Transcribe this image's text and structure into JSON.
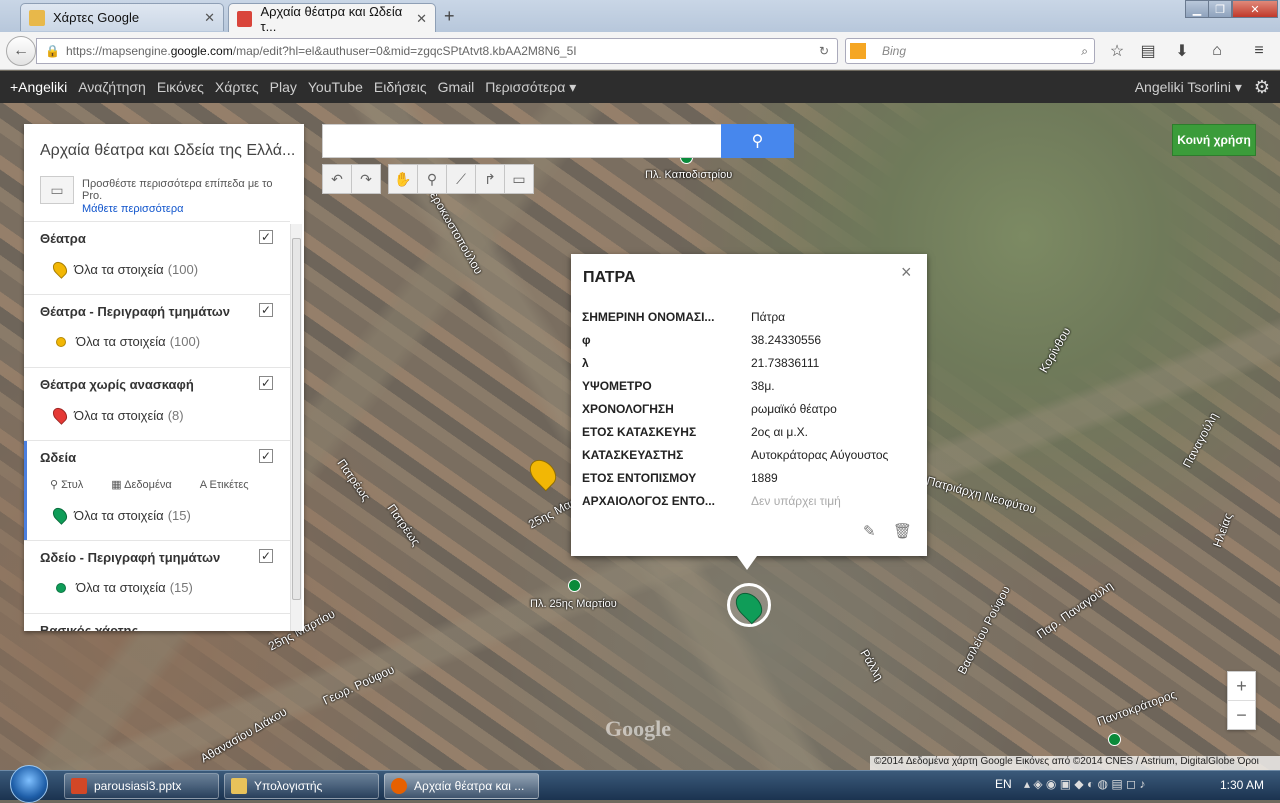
{
  "browser": {
    "tabs": [
      {
        "title": "Χάρτες Google",
        "active": false
      },
      {
        "title": "Αρχαία θέατρα και Ωδεία τ...",
        "active": true
      }
    ],
    "url_prefix": "https://mapsengine.",
    "url_host": "google.com",
    "url_rest": "/map/edit?hl=el&authuser=0&mid=zgqcSPtAtvt8.kbAA2M8N6_5I",
    "search_engine_placeholder": "Bing"
  },
  "google_bar": {
    "items": [
      "+Angeliki",
      "Αναζήτηση",
      "Εικόνες",
      "Χάρτες",
      "Play",
      "YouTube",
      "Ειδήσεις",
      "Gmail",
      "Περισσότερα ▾"
    ],
    "user": "Angeliki Tsorlini ▾"
  },
  "panel": {
    "title": "Αρχαία θέατρα και Ωδεία της Ελλά...",
    "pro_text": "Προσθέστε περισσότερα επίπεδα με το Pro.",
    "pro_link": "Μάθετε περισσότερα",
    "all_items_label": "Όλα τα στοιχεία",
    "layers": [
      {
        "title": "Θέατρα",
        "count": "(100)",
        "icon_color": "#f2b705",
        "icon": "pin-icon"
      },
      {
        "title": "Θέατρα - Περιγραφή τμημάτων",
        "count": "(100)",
        "icon_color": "#f2b705",
        "icon": "dot-icon"
      },
      {
        "title": "Θέατρα χωρίς ανασκαφή",
        "count": "(8)",
        "icon_color": "#e53935",
        "icon": "pin-icon"
      },
      {
        "title": "Ωδεία",
        "count": "(15)",
        "icon_color": "#0f9d58",
        "icon": "pin-icon"
      },
      {
        "title": "Ωδείο - Περιγραφή τμημάτων",
        "count": "(15)",
        "icon_color": "#0f9d58",
        "icon": "dot-icon"
      },
      {
        "title": "Βασικός χάρτης"
      }
    ],
    "subtools": {
      "style": "Στυλ",
      "data": "Δεδομένα",
      "labels": "Ετικέτες"
    }
  },
  "share_button": "Κοινή χρήση",
  "info": {
    "name": "ΠΑΤΡΑ",
    "rows": [
      {
        "key": "ΣΗΜΕΡΙΝΗ ΟΝΟΜΑΣΙ...",
        "value": "Πάτρα"
      },
      {
        "key": "φ",
        "value": "38.24330556"
      },
      {
        "key": "λ",
        "value": "21.73836111"
      },
      {
        "key": "ΥΨΟΜΕΤΡΟ",
        "value": "38μ."
      },
      {
        "key": "ΧΡΟΝΟΛΟΓΗΣΗ",
        "value": "ρωμαϊκό θέατρο"
      },
      {
        "key": "ΕΤΟΣ ΚΑΤΑΣΚΕΥΗΣ",
        "value": "2ος αι μ.Χ."
      },
      {
        "key": "ΚΑΤΑΣΚΕΥΑΣΤΗΣ",
        "value": "Αυτοκράτορας Αύγουστος"
      },
      {
        "key": "ΕΤΟΣ ΕΝΤΟΠΙΣΜΟΥ",
        "value": "1889"
      },
      {
        "key": "ΑΡΧΑΙΟΛΟΓΟΣ ΕΝΤΟ...",
        "value": "Δεν υπάρχει τιμή"
      }
    ]
  },
  "map": {
    "labels": [
      "Πλ. Καποδιστρίου",
      "Πλ. 25ης Μαρτίου",
      "25ης Μαρτίου",
      "Πατρέως",
      "Γεροκωστοπούλου",
      "Κορίνθου",
      "Παναγούλη",
      "Πατριάρχη Νεοφύτου",
      "Ράλλη",
      "Βασιλείου Ρούφου",
      "Παρ. Παναγούλη",
      "Γεωρ. Ρούφου",
      "Αθανασίου Διάκου",
      "Παντοκράτορος",
      "Ηλείας"
    ],
    "google_logo": "Google",
    "attribution": "©2014 Δεδομένα χάρτη Google Εικόνες από ©2014 CNES / Astrium, DigitalGlobe  Όροι"
  },
  "taskbar": {
    "items": [
      "parousiasi3.pptx",
      "Υπολογιστής",
      "Αρχαία θέατρα και ..."
    ],
    "lang": "EN",
    "time": "1:30 AM"
  }
}
